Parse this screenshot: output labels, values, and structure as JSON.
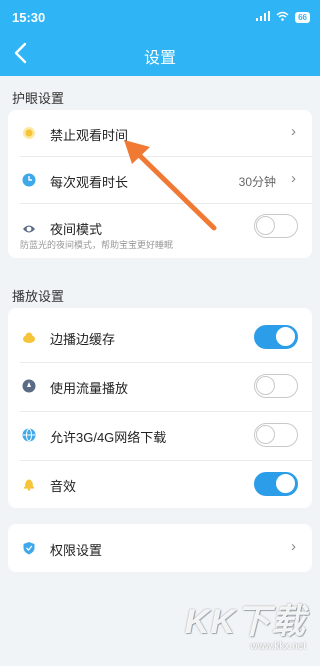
{
  "status_bar": {
    "time": "15:30",
    "battery": "66"
  },
  "header": {
    "title": "设置"
  },
  "eye_section": {
    "title": "护眼设置",
    "items": [
      {
        "label": "禁止观看时间"
      },
      {
        "label": "每次观看时长",
        "value": "30分钟"
      },
      {
        "label": "夜间模式",
        "toggle_on": false
      }
    ],
    "hint": "防蓝光的夜间模式，帮助宝宝更好睡眠"
  },
  "play_section": {
    "title": "播放设置",
    "items": [
      {
        "label": "边播边缓存",
        "toggle_on": true
      },
      {
        "label": "使用流量播放",
        "toggle_on": false
      },
      {
        "label": "允许3G/4G网络下载",
        "toggle_on": false
      },
      {
        "label": "音效",
        "toggle_on": true
      }
    ]
  },
  "permission": {
    "label": "权限设置"
  },
  "watermark": {
    "brand": "KK下载",
    "url": "www.kkx.net"
  },
  "colors": {
    "header": "#2fb4f5",
    "toggle_on": "#2c9de8",
    "arrow": "#f07a34"
  }
}
